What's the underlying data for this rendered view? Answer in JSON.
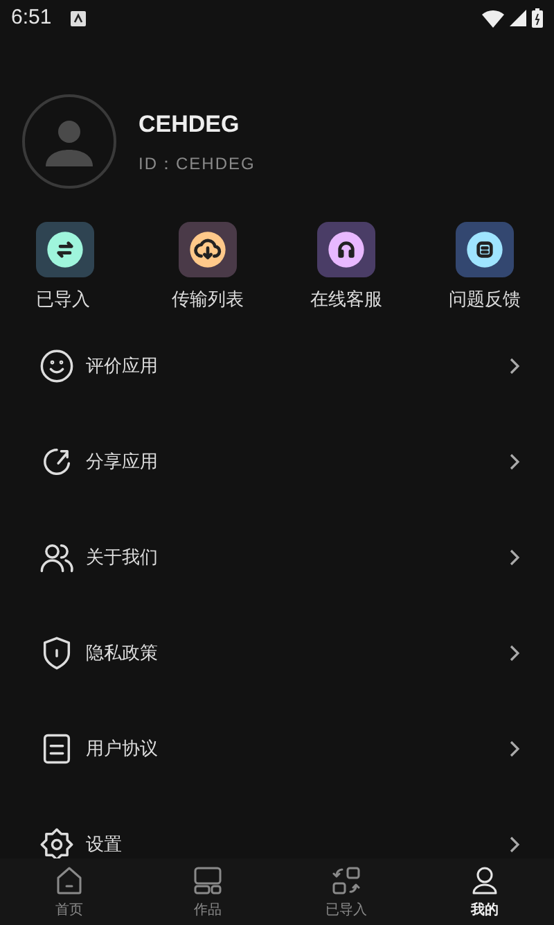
{
  "status_bar": {
    "time": "6:51"
  },
  "profile": {
    "name": "CEHDEG",
    "id": "ID：CEHDEG"
  },
  "shortcuts": [
    {
      "label": "已导入",
      "kind": "import",
      "color": "#9ff5dc"
    },
    {
      "label": "传输列表",
      "kind": "cloud",
      "color": "#ffc98a"
    },
    {
      "label": "在线客服",
      "kind": "headset",
      "color": "#e8b8ff"
    },
    {
      "label": "问题反馈",
      "kind": "feedback",
      "color": "#9fe4ff"
    }
  ],
  "menu": [
    {
      "label": "评价应用",
      "kind": "smile"
    },
    {
      "label": "分享应用",
      "kind": "share"
    },
    {
      "label": "关于我们",
      "kind": "people"
    },
    {
      "label": "隐私政策",
      "kind": "shield"
    },
    {
      "label": "用户协议",
      "kind": "doc"
    },
    {
      "label": "设置",
      "kind": "gear"
    }
  ],
  "tab_bar": [
    {
      "label": "首页",
      "kind": "home",
      "selected": false
    },
    {
      "label": "作品",
      "kind": "works",
      "selected": false
    },
    {
      "label": "已导入",
      "kind": "import",
      "selected": false
    },
    {
      "label": "我的",
      "kind": "me",
      "selected": true
    }
  ]
}
